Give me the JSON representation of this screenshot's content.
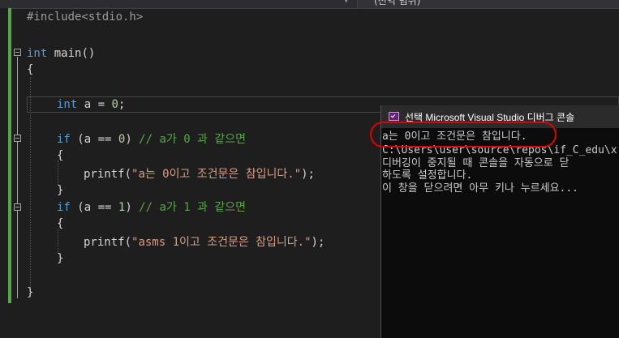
{
  "toolbar": {
    "scope_label": "(전역 범위)"
  },
  "editor": {
    "lines": {
      "include": "#include<stdio.h>",
      "main_kw": "int",
      "main_rest": " main()",
      "open_brace": "{",
      "decl_kw": "int",
      "decl_rest": " a = ",
      "decl_num": "0",
      "decl_end": ";",
      "if1_kw": "if",
      "if1_cond": " (a == ",
      "if1_num": "0",
      "if1_close": ") ",
      "if1_comment": "// a가 0 과 같으면",
      "if1_open": "{",
      "printf1_fn": "printf(",
      "printf1_str": "\"a는 0이고 조건문은 참입니다.\"",
      "printf1_end": ");",
      "if1_close_brace": "}",
      "if2_kw": "if",
      "if2_cond": " (a == ",
      "if2_num": "1",
      "if2_close": ") ",
      "if2_comment": "// a가 1 과 같으면",
      "if2_open": "{",
      "printf2_fn": "printf(",
      "printf2_str": "\"asms 1이고 조건문은 참입니다.\"",
      "printf2_end": ");",
      "if2_close_brace": "}",
      "close_brace": "}"
    }
  },
  "console": {
    "title": "선택 Microsoft Visual Studio 디버그 콘솔",
    "output": [
      "a는 0이고 조건문은 참입니다.",
      "C:\\Users\\user\\source\\repos\\if_C_edu\\x",
      "디버깅이 중지될 때 콘솔을 자동으로 닫",
      "하도록 설정합니다.",
      "이 창을 닫으려면 아무 키나 누르세요..."
    ]
  },
  "colors": {
    "background": "#1e1e1e",
    "keyword": "#569cd6",
    "string": "#d69d85",
    "comment": "#57a64a",
    "annotation_oval": "#e00000"
  }
}
